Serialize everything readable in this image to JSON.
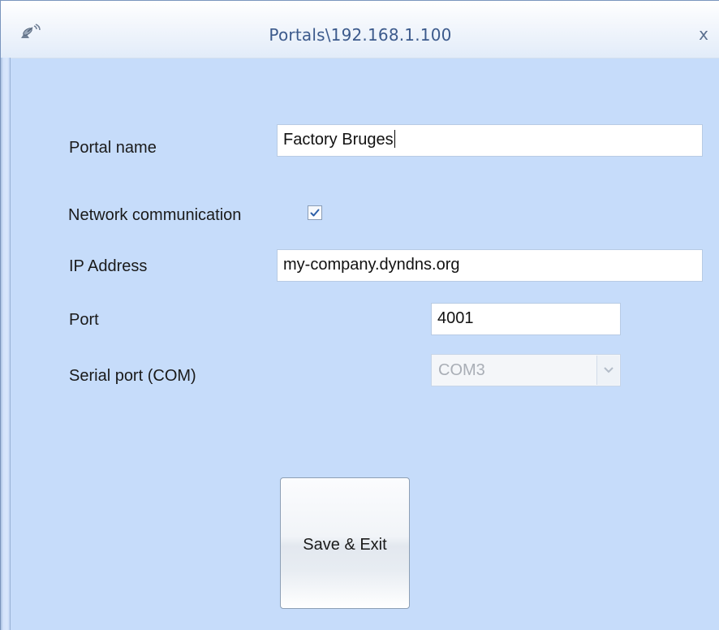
{
  "window": {
    "title": "Portals\\192.168.1.100",
    "close_label": "x"
  },
  "form": {
    "portal_name": {
      "label": "Portal name",
      "value": "Factory Bruges"
    },
    "network_communication": {
      "label": "Network communication",
      "checked": true
    },
    "ip_address": {
      "label": "IP Address",
      "value": "my-company.dyndns.org"
    },
    "port": {
      "label": "Port",
      "value": "4001"
    },
    "serial_port": {
      "label": "Serial port (COM)",
      "value": "COM3",
      "enabled": false
    }
  },
  "actions": {
    "save_label": "Save & Exit"
  },
  "colors": {
    "form_background": "#c6dcfa",
    "title_text": "#3c5a8c",
    "checkbox_check": "#2d5fa8",
    "disabled_text": "#a9aeb6"
  },
  "icons": {
    "app": "satellite-dish-icon",
    "close": "close-icon",
    "check": "checkmark-icon",
    "dropdown": "chevron-down-icon"
  }
}
